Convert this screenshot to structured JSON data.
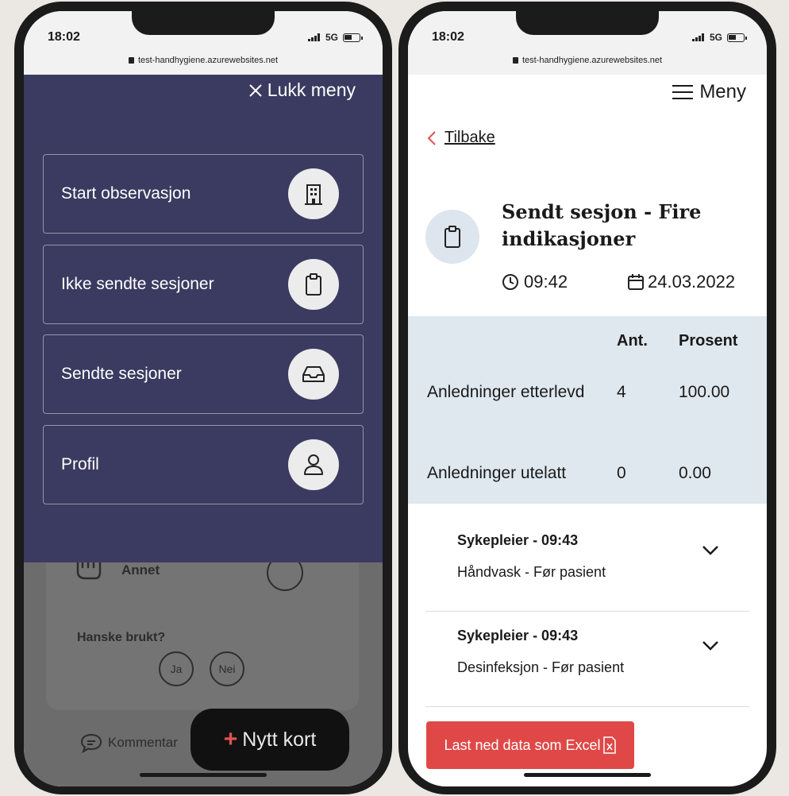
{
  "left_phone": {
    "status": {
      "time": "18:02",
      "network": "5G"
    },
    "url": "test-handhygiene.azurewebsites.net",
    "menu": {
      "close_label": "Lukk meny",
      "items": [
        {
          "label": "Start observasjon",
          "icon": "building-icon"
        },
        {
          "label": "Ikke sendte sesjoner",
          "icon": "clipboard-icon"
        },
        {
          "label": "Sendte sesjoner",
          "icon": "inbox-icon"
        },
        {
          "label": "Profil",
          "icon": "user-icon"
        }
      ]
    },
    "background": {
      "option_label": "Annet",
      "glove_question": "Hanske brukt?",
      "glove_yes": "Ja",
      "glove_no": "Nei",
      "comment_label": "Kommentar",
      "new_card_label": "Nytt kort"
    }
  },
  "right_phone": {
    "status": {
      "time": "18:02",
      "network": "5G"
    },
    "url": "test-handhygiene.azurewebsites.net",
    "menu_label": "Meny",
    "back_label": "Tilbake",
    "session": {
      "title": "Sendt sesjon - Fire indikasjoner",
      "time": "09:42",
      "date": "24.03.2022"
    },
    "stats": {
      "headers": {
        "count": "Ant.",
        "percent": "Prosent"
      },
      "rows": [
        {
          "label": "Anledninger etterlevd",
          "count": "4",
          "percent": "100.00"
        },
        {
          "label": "Anledninger utelatt",
          "count": "0",
          "percent": "0.00"
        }
      ]
    },
    "observations": [
      {
        "title": "Sykepleier - 09:43",
        "detail": "Håndvask - Før pasient"
      },
      {
        "title": "Sykepleier - 09:43",
        "detail": "Desinfeksjon - Før pasient"
      }
    ],
    "download_label": "Last ned data som Excel"
  },
  "colors": {
    "menu_background": "#3b3b61",
    "stats_background": "#dfe8ef",
    "download_button": "#e04848",
    "back_chevron": "#e05252"
  }
}
